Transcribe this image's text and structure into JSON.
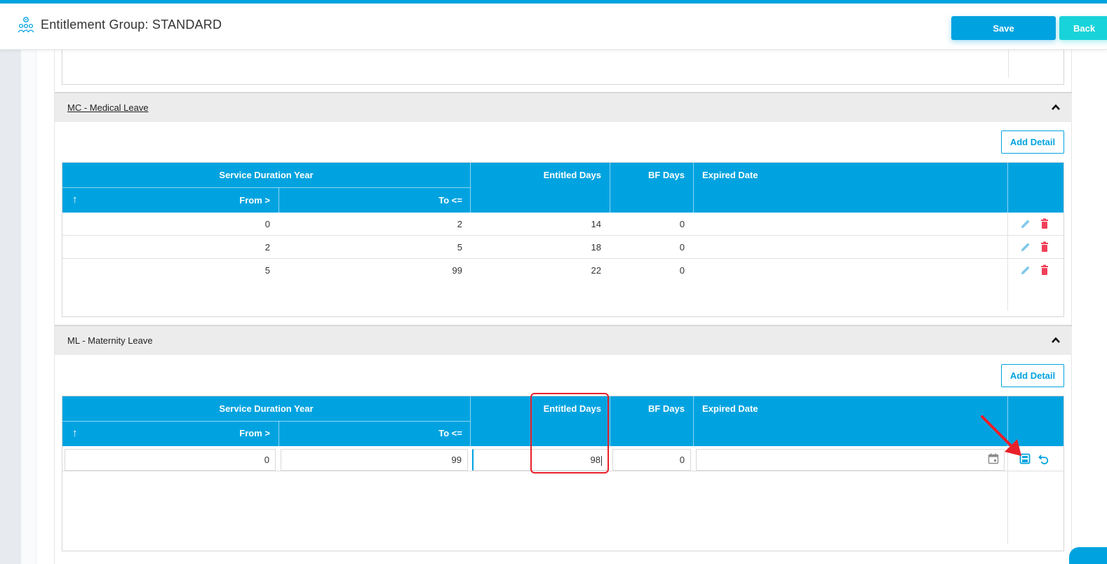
{
  "header": {
    "title": "Entitlement Group: STANDARD",
    "save_label": "Save",
    "back_label": "Back",
    "icon": "group-settings-icon"
  },
  "sections": [
    {
      "title": "MC - Medical Leave",
      "add_label": "Add Detail",
      "columns": {
        "group": "Service Duration Year",
        "from": "From >",
        "to": "To <=",
        "entitled": "Entitled Days",
        "bf": "BF Days",
        "expired": "Expired Date"
      },
      "rows": [
        {
          "from": "0",
          "to": "2",
          "entitled": "14",
          "bf": "0",
          "expired": ""
        },
        {
          "from": "2",
          "to": "5",
          "entitled": "18",
          "bf": "0",
          "expired": ""
        },
        {
          "from": "5",
          "to": "99",
          "entitled": "22",
          "bf": "0",
          "expired": ""
        }
      ]
    },
    {
      "title": "ML - Maternity Leave",
      "add_label": "Add Detail",
      "columns": {
        "group": "Service Duration Year",
        "from": "From >",
        "to": "To <=",
        "entitled": "Entitled Days",
        "bf": "BF Days",
        "expired": "Expired Date"
      },
      "edit_row": {
        "from": "0",
        "to": "99",
        "entitled": "98",
        "bf": "0",
        "expired": ""
      }
    }
  ],
  "colors": {
    "accent": "#00a3e0",
    "back_button": "#19d3da",
    "delete_icon": "#f0405a",
    "highlight": "#e8202a"
  }
}
